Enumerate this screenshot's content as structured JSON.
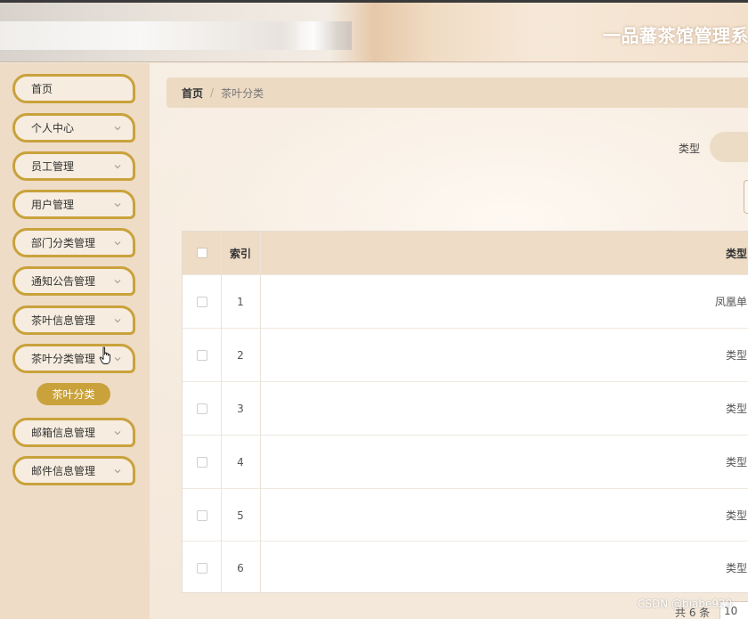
{
  "header": {
    "title": "一品蕃茶馆管理系"
  },
  "sidebar": {
    "items": [
      {
        "label": "首页",
        "has_arrow": false
      },
      {
        "label": "个人中心",
        "has_arrow": true
      },
      {
        "label": "员工管理",
        "has_arrow": true
      },
      {
        "label": "用户管理",
        "has_arrow": true
      },
      {
        "label": "部门分类管理",
        "has_arrow": true
      },
      {
        "label": "通知公告管理",
        "has_arrow": true
      },
      {
        "label": "茶叶信息管理",
        "has_arrow": true
      },
      {
        "label": "茶叶分类管理",
        "has_arrow": true
      },
      {
        "label": "邮箱信息管理",
        "has_arrow": true
      },
      {
        "label": "邮件信息管理",
        "has_arrow": true
      }
    ],
    "active_sub_item": "茶叶分类"
  },
  "breadcrumb": {
    "home": "首页",
    "separator": "/",
    "current": "茶叶分类"
  },
  "search": {
    "label": "类型"
  },
  "table": {
    "columns": [
      "索引",
      "类型"
    ],
    "rows": [
      {
        "index": "1",
        "type": "凤凰单"
      },
      {
        "index": "2",
        "type": "类型"
      },
      {
        "index": "3",
        "type": "类型"
      },
      {
        "index": "4",
        "type": "类型"
      },
      {
        "index": "5",
        "type": "类型"
      },
      {
        "index": "6",
        "type": "类型"
      }
    ]
  },
  "pagination": {
    "total_text": "共 6 条",
    "page_size": "10"
  },
  "watermark": "CSDN @biabe929",
  "colors": {
    "accent": "#c9a23c",
    "sidebar_bg": "#eedcc6",
    "header_bg": "#eedcc6"
  }
}
